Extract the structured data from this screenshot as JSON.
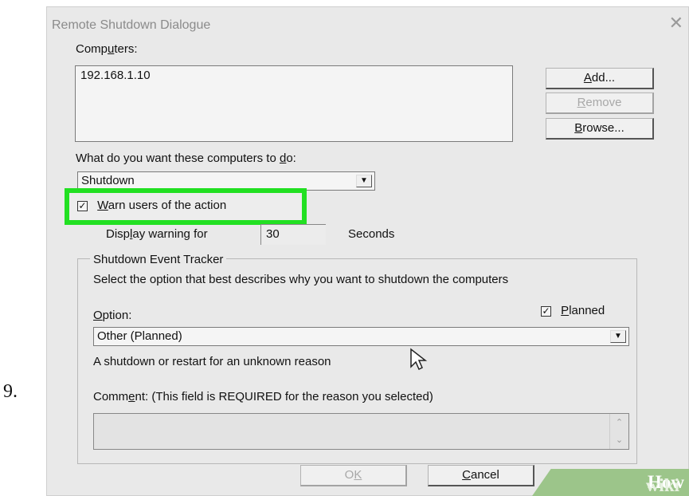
{
  "step": {
    "number": "9."
  },
  "dialog": {
    "title": "Remote Shutdown Dialogue",
    "close_glyph": "✕",
    "computers_label": {
      "pre": "Comp",
      "mnem": "u",
      "post": "ters:"
    },
    "computers": [
      "192.168.1.10"
    ],
    "buttons": {
      "add": {
        "mnem": "A",
        "post": "dd..."
      },
      "remove": {
        "mnem": "R",
        "post": "emove"
      },
      "browse": {
        "mnem": "B",
        "post": "rowse..."
      }
    },
    "action_label": {
      "pre": "What do you want these computers to ",
      "mnem": "d",
      "post": "o:"
    },
    "action_value": "Shutdown",
    "warn_checkbox": {
      "checked": true,
      "mnem": "W",
      "post": "arn users of the action"
    },
    "display_warning": {
      "pre": "Disp",
      "mnem": "l",
      "post": "ay warning for"
    },
    "warning_seconds": "30",
    "seconds_label": "Seconds",
    "tracker": {
      "legend": "Shutdown Event Tracker",
      "description": "Select the option that best describes why you want to shutdown the computers",
      "option_label": {
        "mnem": "O",
        "post": "ption:"
      },
      "planned": {
        "checked": true,
        "mnem": "P",
        "post": "lanned"
      },
      "option_value": "Other (Planned)",
      "option_description": "A shutdown or restart for an unknown reason",
      "comment_label": {
        "pre": "Comm",
        "mnem": "e",
        "post": "nt: (This field is REQUIRED for the reason you selected)"
      },
      "comment_value": ""
    },
    "ok": {
      "pre": "O",
      "mnem": "K"
    },
    "cancel": {
      "mnem": "C",
      "post": "ancel"
    }
  },
  "watermark": {
    "wiki": "wiki",
    "how": "How"
  },
  "colors": {
    "highlight": "#22e022",
    "dialog_bg": "#e9e9e9",
    "watermark_bg": "#9cc58a"
  }
}
